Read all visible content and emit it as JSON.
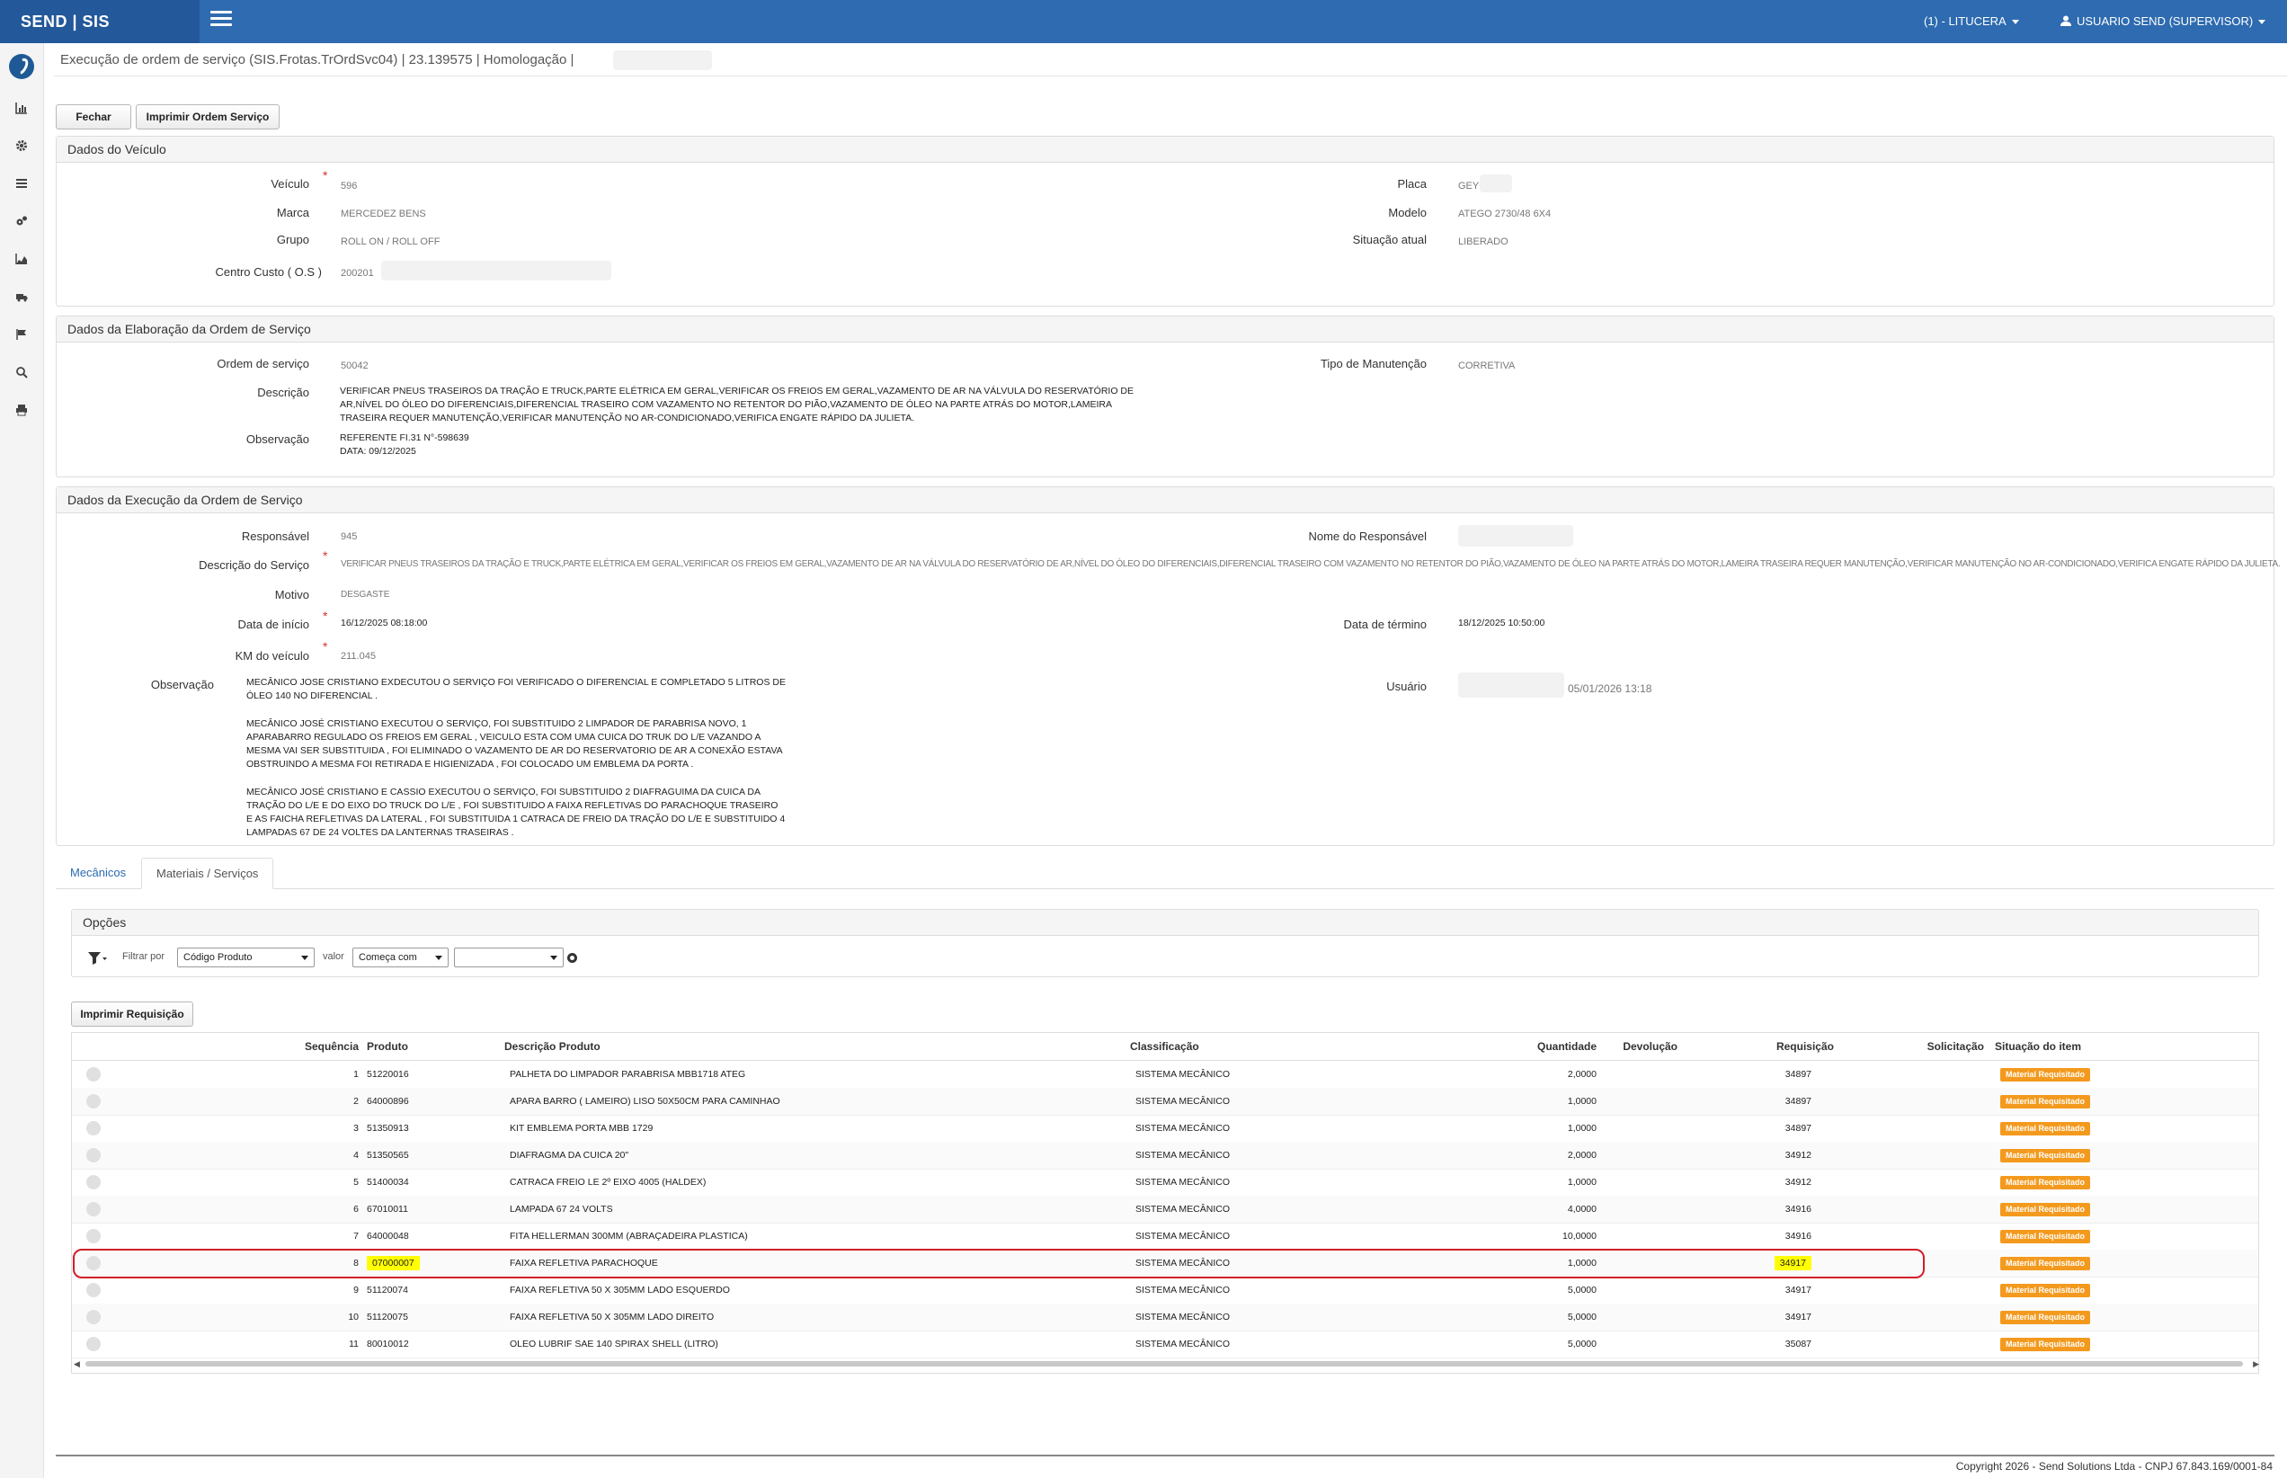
{
  "brand": "SEND | SIS",
  "topbar": {
    "company": "(1) - LITUCERA",
    "user": "USUARIO SEND (SUPERVISOR)"
  },
  "title": "Execução de ordem de serviço (SIS.Frotas.TrOrdSvc04) | 23.139575 | Homologação |",
  "buttons": {
    "close": "Fechar",
    "print_os": "Imprimir Ordem Serviço",
    "print_req": "Imprimir Requisição"
  },
  "vehicle": {
    "header": "Dados do Veículo",
    "veiculo_label": "Veículo",
    "veiculo": "596",
    "marca_label": "Marca",
    "marca": "MERCEDEZ BENS",
    "grupo_label": "Grupo",
    "grupo": "ROLL ON / ROLL OFF",
    "cc_label": "Centro Custo ( O.S )",
    "cc": "200201",
    "placa_label": "Placa",
    "placa": "GEYC",
    "modelo_label": "Modelo",
    "modelo": "ATEGO 2730/48 6X4",
    "situacao_label": "Situação atual",
    "situacao": "LIBERADO"
  },
  "elaboration": {
    "header": "Dados da Elaboração da Ordem de Serviço",
    "os_label": "Ordem de serviço",
    "os": "50042",
    "desc_label": "Descrição",
    "desc": "VERIFICAR PNEUS TRASEIROS DA TRAÇÃO E TRUCK,PARTE ELÉTRICA EM GERAL,VERIFICAR OS FREIOS EM GERAL,VAZAMENTO DE AR NA VÁLVULA DO RESERVATÓRIO DE AR,NÍVEL DO ÓLEO DO DIFERENCIAIS,DIFERENCIAL TRASEIRO COM VAZAMENTO NO RETENTOR DO PIÃO,VAZAMENTO DE ÓLEO NA PARTE ATRÁS DO MOTOR,LAMEIRA TRASEIRA REQUER MANUTENÇÃO,VERIFICAR MANUTENÇÃO NO AR-CONDICIONADO,VERIFICA ENGATE RÁPIDO DA JULIETA.",
    "obs_label": "Observação",
    "obs_line1": "REFERENTE FI.31 N°-598639",
    "obs_line2": "DATA: 09/12/2025",
    "tipo_label": "Tipo de Manutenção",
    "tipo": "CORRETIVA"
  },
  "execution": {
    "header": "Dados da Execução da Ordem de Serviço",
    "resp_label": "Responsável",
    "resp": "945",
    "nome_resp_label": "Nome do Responsável",
    "desc_label": "Descrição do Serviço",
    "desc": "VERIFICAR PNEUS TRASEIROS DA TRAÇÃO E TRUCK,PARTE ELÉTRICA EM GERAL,VERIFICAR OS FREIOS EM GERAL,VAZAMENTO DE AR NA VÁLVULA DO RESERVATÓRIO DE AR,NÍVEL DO ÓLEO DO DIFERENCIAIS,DIFERENCIAL TRASEIRO COM VAZAMENTO NO RETENTOR DO PIÃO,VAZAMENTO DE ÓLEO NA PARTE ATRÁS DO MOTOR,LAMEIRA TRASEIRA REQUER MANUTENÇÃO,VERIFICAR MANUTENÇÃO NO AR-CONDICIONADO,VERIFICA ENGATE RÁPIDO DA JULIETA.",
    "motivo_label": "Motivo",
    "motivo": "DESGASTE",
    "inicio_label": "Data de início",
    "inicio": "16/12/2025 08:18:00",
    "termino_label": "Data de término",
    "termino": "18/12/2025 10:50:00",
    "km_label": "KM do veículo",
    "km": "211.045",
    "obs_label": "Observação",
    "obs_p1": "MECÂNICO JOSE CRISTIANO EXDECUTOU O SERVIÇO FOI VERIFICADO O DIFERENCIAL E COMPLETADO 5 LITROS DE ÓLEO 140 NO DIFERENCIAL .",
    "obs_p2": "MECÂNICO JOSÉ CRISTIANO EXECUTOU O SERVIÇO, FOI SUBSTITUIDO 2 LIMPADOR DE PARABRISA NOVO, 1 APARABARRO REGULADO OS FREIOS EM GERAL , VEICULO ESTA COM UMA CUICA DO TRUK DO L/E VAZANDO A MESMA VAI SER SUBSTITUIDA , FOI ELIMINADO O VAZAMENTO DE AR DO RESERVATORIO DE AR A CONEXÃO ESTAVA OBSTRUINDO A MESMA FOI RETIRADA E HIGIENIZADA , FOI COLOCADO UM EMBLEMA DA PORTA .",
    "obs_p3": "MECÂNICO JOSÉ CRISTIANO E CASSIO EXECUTOU O SERVIÇO, FOI SUBSTITUIDO 2 DIAFRAGUIMA DA CUICA DA TRAÇÃO DO L/E E DO EIXO DO TRUCK DO L/E , FOI SUBSTITUIDO A FAIXA REFLETIVAS DO PARACHOQUE TRASEIRO E AS FAICHA REFLETIVAS DA LATERAL , FOI SUBSTITUIDA 1 CATRACA DE FREIO DA TRAÇÃO DO L/E E SUBSTITUIDO 4 LAMPADAS 67 DE 24 VOLTES DA LANTERNAS TRASEIRAS .",
    "usuario_label": "Usuário",
    "usuario_date": "05/01/2026 13:18"
  },
  "tabs": [
    "Mecânicos",
    "Materiais / Serviços"
  ],
  "options": {
    "header": "Opções",
    "filter_label": "Filtrar por",
    "filter_field": "Código Produto",
    "value_label": "valor",
    "match": "Começa com",
    "value": ""
  },
  "grid": {
    "headers": [
      "Sequência",
      "Produto",
      "Descrição Produto",
      "Classificação",
      "Quantidade",
      "Devolução",
      "Requisição",
      "Solicitação",
      "Situação do item"
    ],
    "rows": [
      {
        "seq": "1",
        "prod": "51220016",
        "desc": "PALHETA DO LIMPADOR PARABRISA MBB1718 ATEG",
        "cls": "SISTEMA MECÂNICO",
        "qtd": "2,0000",
        "dev": "",
        "req": "34897",
        "sol": "",
        "sit": "Material Requisitado"
      },
      {
        "seq": "2",
        "prod": "64000896",
        "desc": "APARA BARRO ( LAMEIRO) LISO 50X50CM PARA CAMINHAO",
        "cls": "SISTEMA MECÂNICO",
        "qtd": "1,0000",
        "dev": "",
        "req": "34897",
        "sol": "",
        "sit": "Material Requisitado"
      },
      {
        "seq": "3",
        "prod": "51350913",
        "desc": "KIT EMBLEMA PORTA MBB 1729",
        "cls": "SISTEMA MECÂNICO",
        "qtd": "1,0000",
        "dev": "",
        "req": "34897",
        "sol": "",
        "sit": "Material Requisitado"
      },
      {
        "seq": "4",
        "prod": "51350565",
        "desc": "DIAFRAGMA DA CUICA 20\"",
        "cls": "SISTEMA MECÂNICO",
        "qtd": "2,0000",
        "dev": "",
        "req": "34912",
        "sol": "",
        "sit": "Material Requisitado"
      },
      {
        "seq": "5",
        "prod": "51400034",
        "desc": "CATRACA FREIO LE 2º EIXO 4005 (HALDEX)",
        "cls": "SISTEMA MECÂNICO",
        "qtd": "1,0000",
        "dev": "",
        "req": "34912",
        "sol": "",
        "sit": "Material Requisitado"
      },
      {
        "seq": "6",
        "prod": "67010011",
        "desc": "LAMPADA 67 24 VOLTS",
        "cls": "SISTEMA MECÂNICO",
        "qtd": "4,0000",
        "dev": "",
        "req": "34916",
        "sol": "",
        "sit": "Material Requisitado"
      },
      {
        "seq": "7",
        "prod": "64000048",
        "desc": "FITA HELLERMAN 300MM (ABRAÇADEIRA PLASTICA)",
        "cls": "SISTEMA MECÂNICO",
        "qtd": "10,0000",
        "dev": "",
        "req": "34916",
        "sol": "",
        "sit": "Material Requisitado"
      },
      {
        "seq": "8",
        "prod": "07000007",
        "desc": "FAIXA REFLETIVA PARACHOQUE",
        "cls": "SISTEMA MECÂNICO",
        "qtd": "1,0000",
        "dev": "",
        "req": "34917",
        "sol": "",
        "sit": "Material Requisitado"
      },
      {
        "seq": "9",
        "prod": "51120074",
        "desc": "FAIXA REFLETIVA 50 X 305MM LADO ESQUERDO",
        "cls": "SISTEMA MECÂNICO",
        "qtd": "5,0000",
        "dev": "",
        "req": "34917",
        "sol": "",
        "sit": "Material Requisitado"
      },
      {
        "seq": "10",
        "prod": "51120075",
        "desc": "FAIXA REFLETIVA 50 X 305MM LADO DIREITO",
        "cls": "SISTEMA MECÂNICO",
        "qtd": "5,0000",
        "dev": "",
        "req": "34917",
        "sol": "",
        "sit": "Material Requisitado"
      },
      {
        "seq": "11",
        "prod": "80010012",
        "desc": "OLEO LUBRIF SAE 140 SPIRAX SHELL (LITRO)",
        "cls": "SISTEMA MECÂNICO",
        "qtd": "5,0000",
        "dev": "",
        "req": "35087",
        "sol": "",
        "sit": "Material Requisitado"
      }
    ]
  },
  "colors": {
    "topbar": "#2e6bb0",
    "brand_bg": "#23589a",
    "badge": "#f39a1e",
    "highlight": "#ffff00",
    "annotation": "#d0202a"
  },
  "footer": "Copyright 2026 - Send Solutions Ltda - CNPJ 67.843.169/0001-84"
}
